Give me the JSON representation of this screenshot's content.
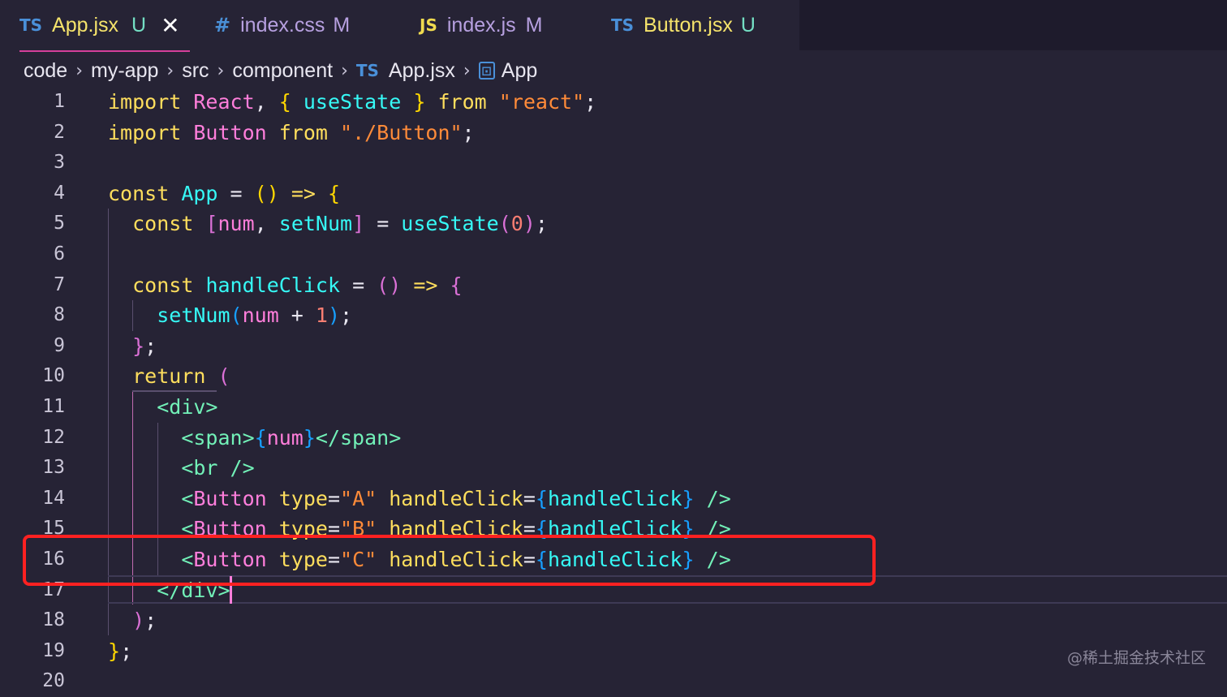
{
  "tabs": [
    {
      "icon": "TS",
      "name": "App.jsx",
      "flag": "U",
      "active": true
    },
    {
      "icon": "#",
      "name": "index.css",
      "flag": "M",
      "active": false
    },
    {
      "icon": "JS",
      "name": "index.js",
      "flag": "M",
      "active": false
    },
    {
      "icon": "TS",
      "name": "Button.jsx",
      "flag": "U",
      "active": false
    }
  ],
  "close_glyph": "✕",
  "breadcrumb": {
    "parts": [
      "code",
      "my-app",
      "src",
      "component"
    ],
    "file_icon": "TS",
    "file": "App.jsx",
    "symbol_icon": "symbol-icon",
    "symbol": "App",
    "separator": "›"
  },
  "line_numbers": [
    "1",
    "2",
    "3",
    "4",
    "5",
    "6",
    "7",
    "8",
    "9",
    "10",
    "11",
    "12",
    "13",
    "14",
    "15",
    "16",
    "17",
    "18",
    "19",
    "20"
  ],
  "code_lines": [
    "import React, { useState } from \"react\";",
    "import Button from \"./Button\";",
    "",
    "const App = () => {",
    "  const [num, setNum] = useState(0);",
    "",
    "  const handleClick = () => {",
    "    setNum(num + 1);",
    "  };",
    "  return (",
    "    <div>",
    "      <span>{num}</span>",
    "      <br />",
    "      <Button type=\"A\" handleClick={handleClick} />",
    "      <Button type=\"B\" handleClick={handleClick} />",
    "      <Button type=\"C\" handleClick={handleClick} />",
    "    </div>",
    "  );",
    "};",
    ""
  ],
  "highlight_line": "16",
  "watermark": "@稀土掘金技术社区",
  "colors": {
    "background": "#262335",
    "keyword": "#fede5d",
    "component": "#ff7edb",
    "function": "#36f9f6",
    "string": "#ff8b39",
    "tag": "#72f1b8",
    "highlight_box": "#ff2121"
  }
}
